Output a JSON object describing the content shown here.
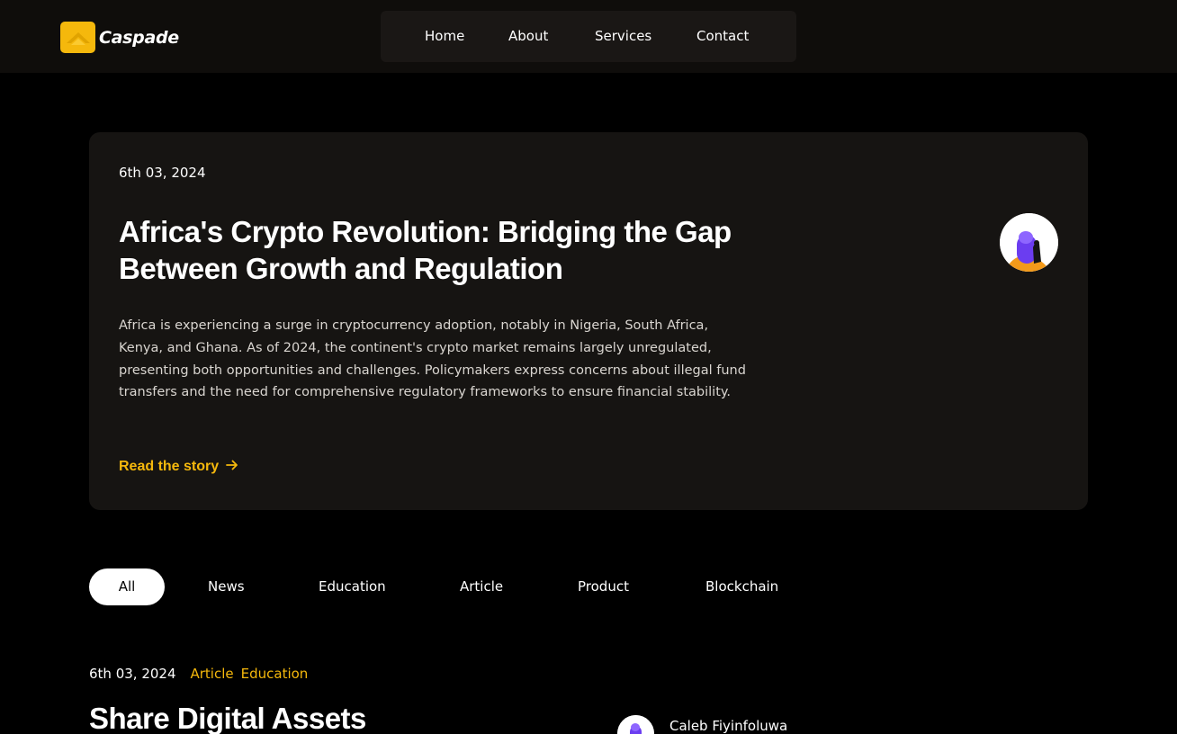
{
  "brand": {
    "name": "Caspade",
    "accent": "#f5b80c",
    "logo_icon": "chevron-up-logo-icon"
  },
  "nav": {
    "items": [
      "Home",
      "About",
      "Services",
      "Contact"
    ]
  },
  "hero": {
    "date": "6th 03, 2024",
    "title": "Africa's Crypto Revolution: Bridging the Gap Between Growth and Regulation",
    "body": "Africa is experiencing a surge in cryptocurrency adoption, notably in Nigeria, South Africa, Kenya, and Ghana. As of 2024, the continent's crypto market remains largely unregulated, presenting both opportunities and challenges. Policymakers express concerns about illegal fund transfers and the need for comprehensive regulatory frameworks to ensure financial stability.",
    "link_label": "Read the story",
    "link_icon": "arrow-right-icon"
  },
  "filters": {
    "active": "All",
    "items": [
      "All",
      "News",
      "Education",
      "Article",
      "Product",
      "Blockchain"
    ]
  },
  "post": {
    "date": "6th 03, 2024",
    "tags": [
      "Article",
      "Education"
    ],
    "title": "Share Digital Assets",
    "author": "Caleb Fiyinfoluwa"
  }
}
